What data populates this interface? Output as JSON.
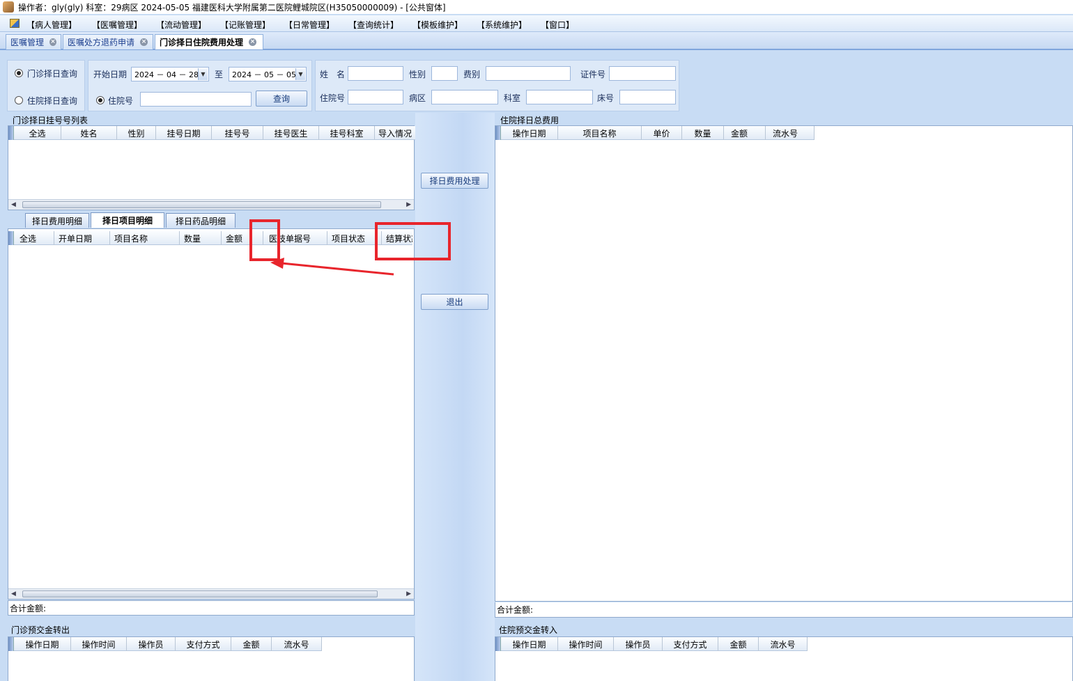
{
  "titlebar": {
    "text": "操作者：gly(gly)  科室：29病区  2024-05-05  福建医科大学附属第二医院鲤城院区(H35050000009) - [公共窗体]"
  },
  "menu": [
    "【病人管理】",
    "【医嘱管理】",
    "【流动管理】",
    "【记账管理】",
    "【日常管理】",
    "【查询统计】",
    "【模板维护】",
    "【系统维护】",
    "【窗口】"
  ],
  "doc_tabs": [
    "医嘱管理",
    "医嘱处方退药申请",
    "门诊择日住院费用处理"
  ],
  "query": {
    "radio_outpatient": "门诊择日查询",
    "radio_inpatient": "住院择日查询",
    "start_label": "开始日期",
    "start_value": "2024 － 04 － 28",
    "to_label": "至",
    "end_value": "2024 － 05 － 05",
    "inpatient_no_radio": "住院号",
    "search_button": "查询",
    "name_label": "姓　名",
    "gender_label": "性别",
    "fee_type_label": "费别",
    "id_label": "证件号",
    "admission_no_label": "住院号",
    "ward_label": "病区",
    "dept_label": "科室",
    "bed_label": "床号"
  },
  "reg_list": {
    "title": "门诊择日挂号号列表",
    "columns": [
      "全选",
      "姓名",
      "性别",
      "挂号日期",
      "挂号号",
      "挂号医生",
      "挂号科室",
      "导入情况"
    ]
  },
  "subtabs": [
    "择日费用明细",
    "择日项目明细",
    "择日药品明细"
  ],
  "item_detail": {
    "columns": [
      "全选",
      "开单日期",
      "项目名称",
      "数量",
      "金额",
      "医技单据号",
      "项目状态",
      "结算状态"
    ],
    "sum_label": "合计金额:"
  },
  "actions": {
    "process_button": "择日费用处理",
    "exit_button": "退出"
  },
  "inpatient_fees": {
    "title": "住院择日总费用",
    "columns": [
      "操作日期",
      "项目名称",
      "单价",
      "数量",
      "金额",
      "流水号"
    ],
    "sum_label": "合计金额:"
  },
  "prepay_out": {
    "title": "门诊预交金转出",
    "columns": [
      "操作日期",
      "操作时间",
      "操作员",
      "支付方式",
      "金额",
      "流水号"
    ]
  },
  "prepay_in": {
    "title": "住院预交金转入",
    "columns": [
      "操作日期",
      "操作时间",
      "操作员",
      "支付方式",
      "金额",
      "流水号"
    ]
  },
  "colors": {
    "annotation": "#e8252c",
    "panel": "#dde9f8",
    "background": "#c8dcf4"
  }
}
